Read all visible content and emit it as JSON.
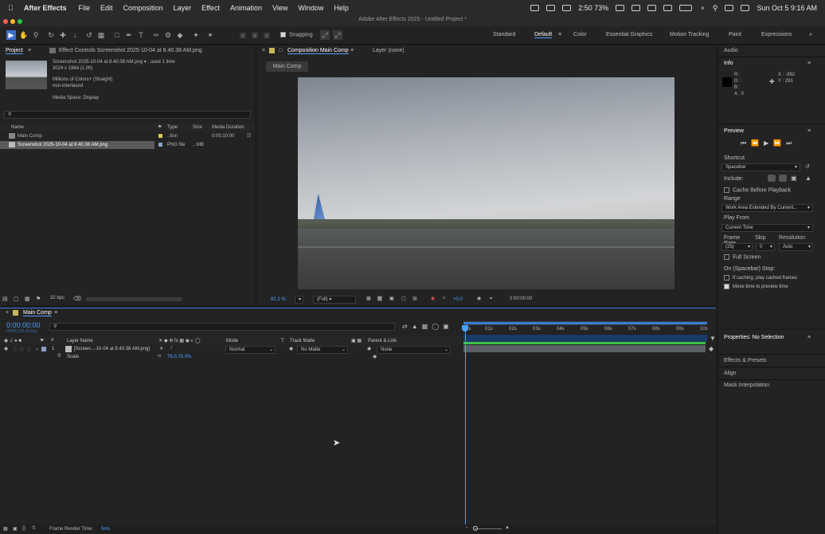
{
  "menubar": {
    "app_name": "After Effects",
    "items": [
      "File",
      "Edit",
      "Composition",
      "Layer",
      "Effect",
      "Animation",
      "View",
      "Window",
      "Help"
    ],
    "clock_timer": "2:50",
    "battery_pct": "73%",
    "datetime": "Sun Oct 5  9:16 AM"
  },
  "window": {
    "title": "Adobe After Effects 2025 - Untitled Project *"
  },
  "toolbar": {
    "snapping_label": "Snapping",
    "workspaces": [
      "Standard",
      "Default",
      "Color",
      "Essential Graphics",
      "Motion Tracking",
      "Paint",
      "Expressions"
    ],
    "active_workspace": "Default"
  },
  "project": {
    "tab_label": "Project",
    "effect_controls_label": "Effect Controls Screenshot 2025-10-04 at 8.40.38 AM.png",
    "file_name": "Screenshot 2025-10-04 at 8.40.38 AM.png ▾ , used 1 time",
    "dimensions": "3024 x 1964 (1.00)",
    "color_info": "Millions of Colors+ (Straight)",
    "interlace": "non-interlaced",
    "media_space": "Media Space: Display",
    "columns": {
      "name": "Name",
      "type": "Type",
      "size": "Size",
      "duration": "Media Duration"
    },
    "items": [
      {
        "name": "Main Comp",
        "type": "..tion",
        "size": "",
        "duration": "0:00:10:00"
      },
      {
        "name": "Screenshot 2025-10-04 at 8.40.38 AM.png",
        "type": "PNG file",
        "size": "...MB",
        "duration": ""
      }
    ],
    "bpc": "32 bpc"
  },
  "composition": {
    "tab_label": "Composition Main Comp",
    "layer_tab": "Layer (none)",
    "breadcrumb": "Main Comp",
    "zoom": "82.2  %",
    "resolution": "(Full)",
    "exposure": "+0.0",
    "timecode": "0:00:00:00"
  },
  "info": {
    "audio_tab": "Audio",
    "title": "Info",
    "r": "R :",
    "g": "G :",
    "b": "B :",
    "a": "A :  0",
    "x": "X : -392",
    "y": "Y : 291"
  },
  "preview": {
    "title": "Preview",
    "shortcut_label": "Shortcut",
    "shortcut_value": "Spacebar",
    "include_label": "Include:",
    "cache_label": "Cache Before Playback",
    "range_label": "Range",
    "range_value": "Work Area Extended By Current...",
    "play_from_label": "Play From",
    "play_from_value": "Current Time",
    "frame_rate_label": "Frame Rate",
    "frame_rate_value": "(25)",
    "skip_label": "Skip",
    "skip_value": "0",
    "resolution_label": "Resolution",
    "resolution_value": "Auto",
    "full_screen_label": "Full Screen",
    "stop_label": "On (Spacebar) Stop:",
    "cached_label": "If caching, play cached frames",
    "move_time_label": "Move time to preview time"
  },
  "properties": {
    "title": "Properties: No Selection",
    "sections": [
      "Effects & Presets",
      "Align",
      "Mask Interpolation"
    ]
  },
  "timeline": {
    "tab_label": "Main Comp",
    "timecode": "0:00:00:00",
    "timecode_sub": "00000 (25.00 fps)",
    "columns": {
      "num": "#",
      "layer_name": "Layer Name",
      "mode": "Mode",
      "t": "T",
      "track_matte": "Track Matte",
      "parent": "Parent & Link"
    },
    "layer": {
      "num": "1",
      "name": "[Screen...-10-04 at 8.40.38 AM.png]",
      "mode": "Normal",
      "matte": "No Matte",
      "parent": "None"
    },
    "scale_label": "Scale",
    "scale_value": "76.0,76.0%",
    "ruler": [
      "0s",
      "01s",
      "02s",
      "03s",
      "04s",
      "05s",
      "06s",
      "07s",
      "08s",
      "09s",
      "10s"
    ],
    "frame_render_label": "Frame Render Time:",
    "frame_render_value": "5ms"
  }
}
